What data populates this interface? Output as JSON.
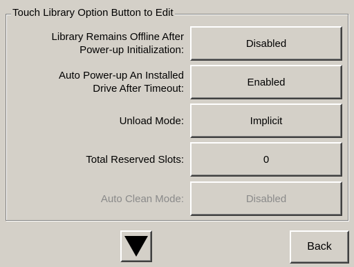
{
  "group": {
    "title": "Touch Library Option Button to Edit"
  },
  "options": [
    {
      "label_lines": [
        "Library Remains Offline After",
        "Power-up Initialization:"
      ],
      "value": "Disabled",
      "enabled": true
    },
    {
      "label_lines": [
        "Auto Power-up An Installed",
        "Drive After Timeout:"
      ],
      "value": "Enabled",
      "enabled": true
    },
    {
      "label_lines": [
        "Unload Mode:"
      ],
      "value": "Implicit",
      "enabled": true
    },
    {
      "label_lines": [
        "Total Reserved Slots:"
      ],
      "value": "0",
      "enabled": true
    },
    {
      "label_lines": [
        "Auto Clean Mode:"
      ],
      "value": "Disabled",
      "enabled": false
    }
  ],
  "navigation": {
    "scroll_icon": "arrow-down-icon",
    "back_label": "Back"
  },
  "colors": {
    "background": "#d4d0c8",
    "disabled_text": "#8a8a8a"
  }
}
